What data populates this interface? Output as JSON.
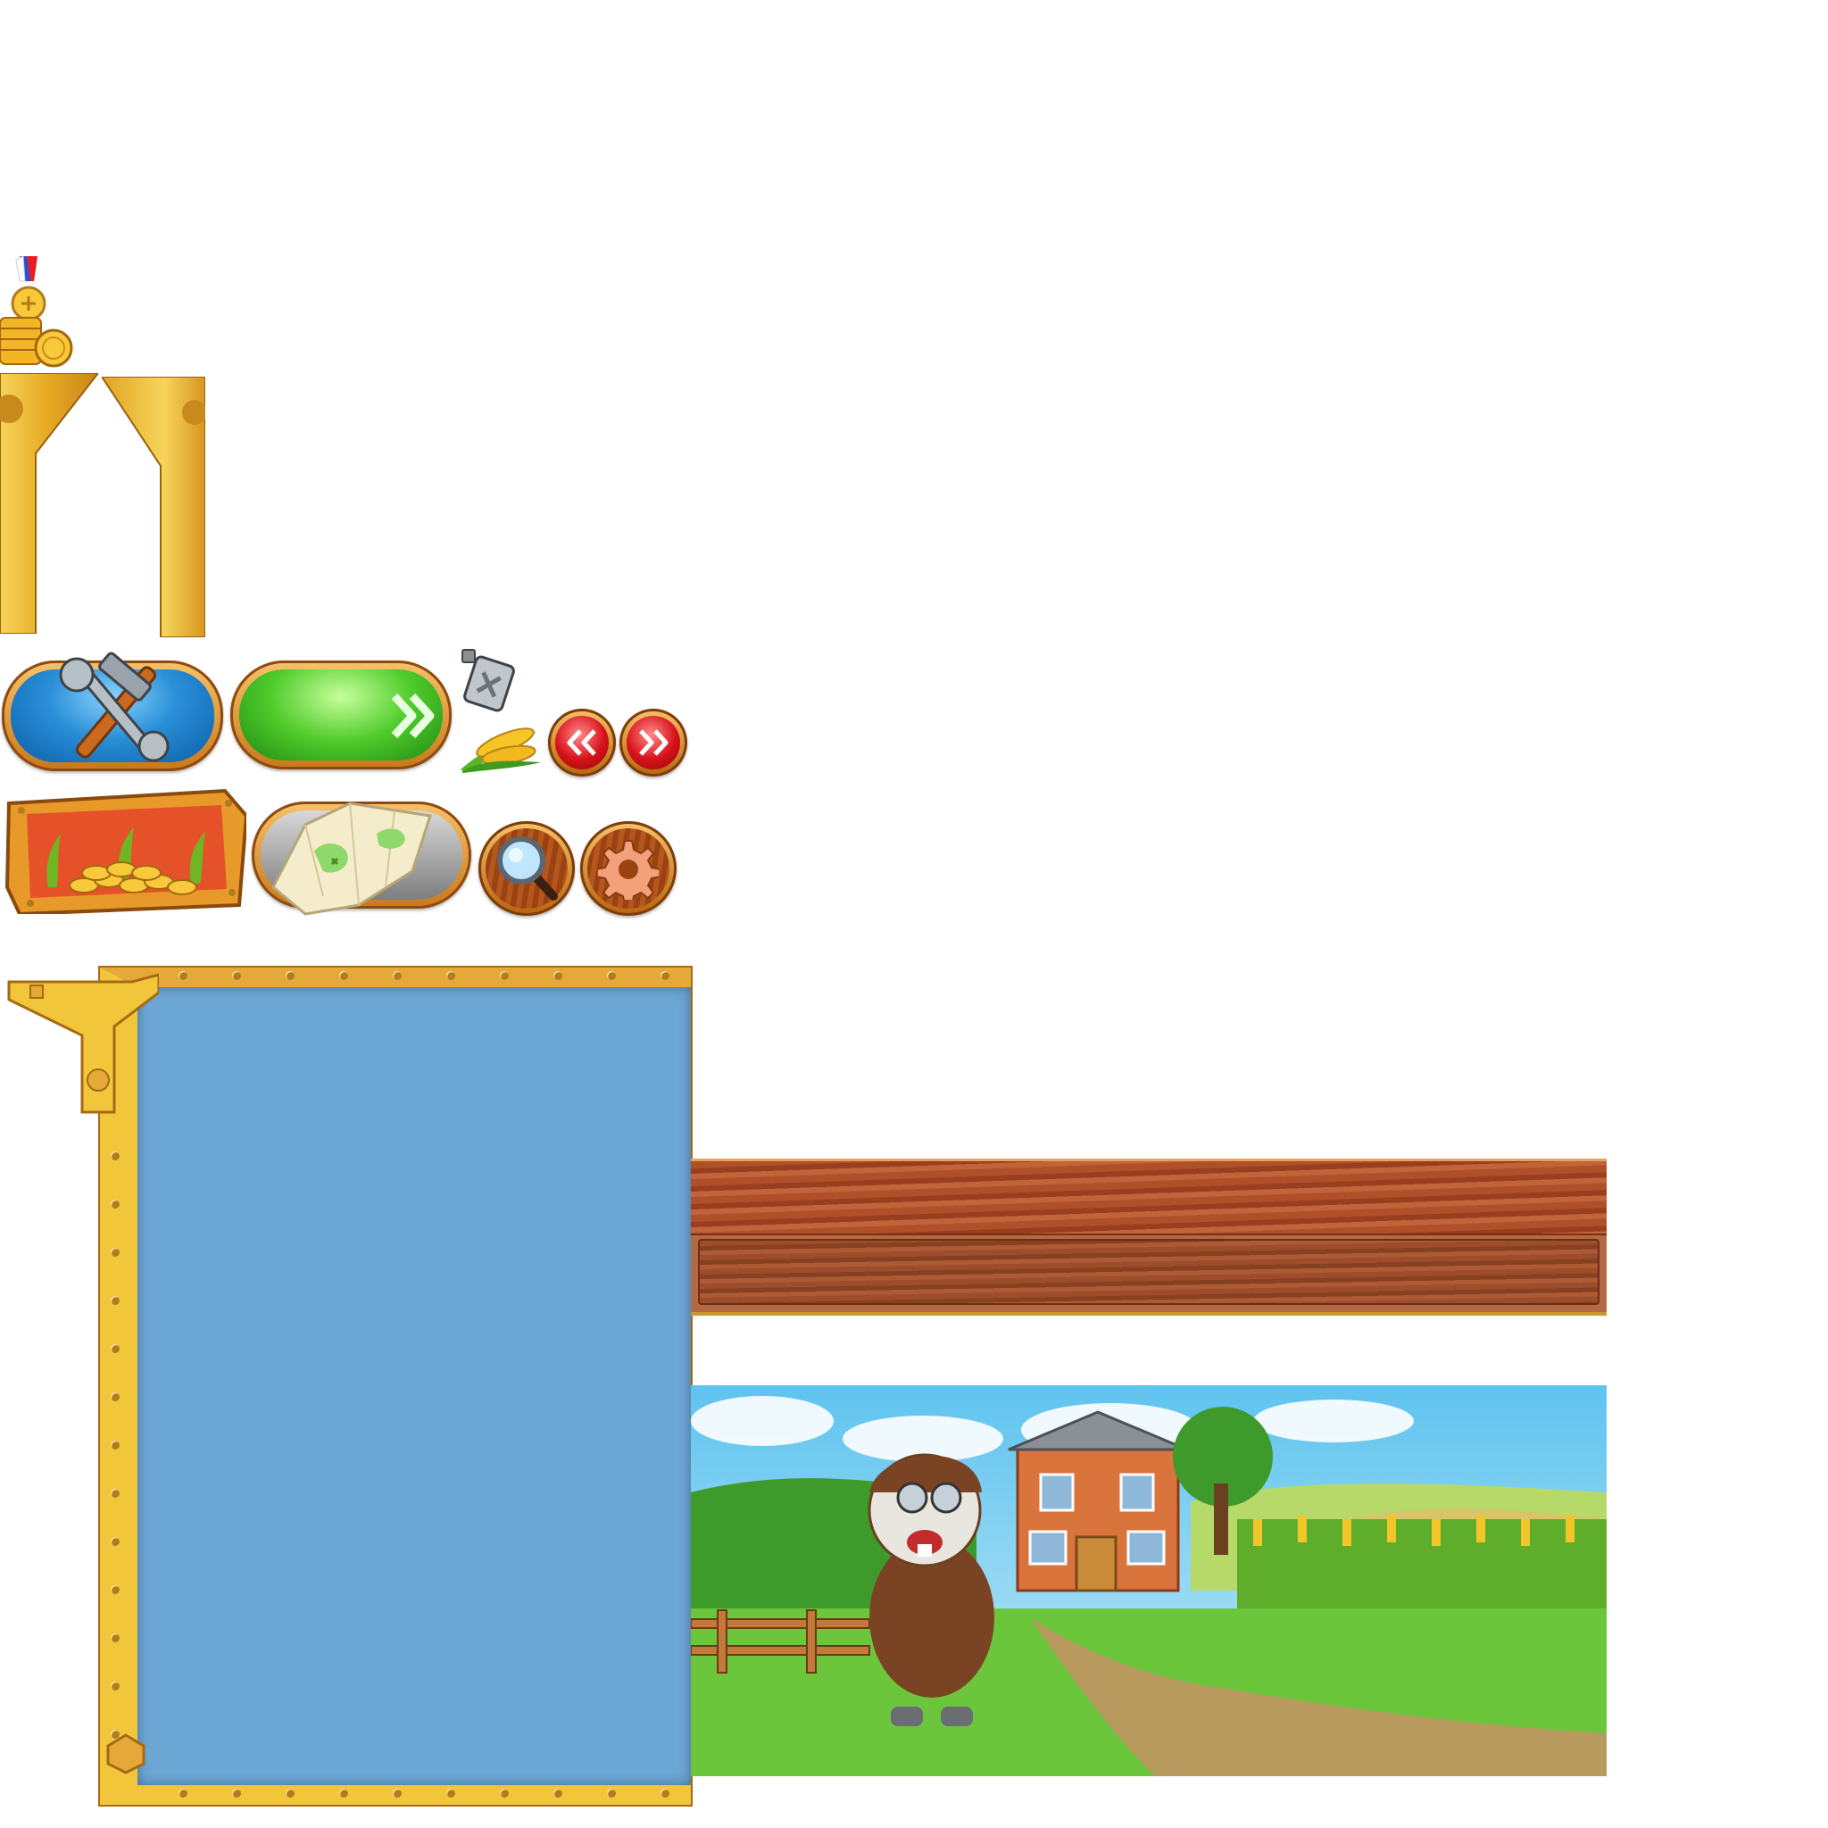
{
  "sprites": {
    "medal": {
      "icon": "medal-icon"
    },
    "coins": {
      "icon": "coin-stack-icon"
    },
    "gold_arms": {
      "icon": "gold-frame-arm-icon"
    },
    "tools_button": {
      "icon": "wrench-hammer-icon",
      "color": "#1e7fd0"
    },
    "go_button": {
      "icon": "double-chevron-right-icon",
      "color": "#3fbf22"
    },
    "fuel_can": {
      "icon": "fuel-can-icon"
    },
    "corn": {
      "icon": "corn-icon"
    },
    "prev_button": {
      "icon": "double-chevron-left-icon",
      "color": "#d8111a"
    },
    "next_button": {
      "icon": "double-chevron-right-icon",
      "color": "#d8111a"
    },
    "reward_sign": {
      "icon": "gold-coins-sign-icon",
      "color": "#e8592a"
    },
    "map_button": {
      "icon": "map-icon"
    },
    "search_button": {
      "icon": "magnifier-icon"
    },
    "settings_button": {
      "icon": "gear-icon"
    }
  },
  "main_frame": {
    "color": "#6ca7d6",
    "border_color": "#f2c63b"
  },
  "wood_bars": {
    "color": "#a84b24"
  },
  "farm_scene": {
    "subject": "hamster-pilot-farm-illustration",
    "sky": "#7fd0f2",
    "grass": "#6cc63c"
  }
}
